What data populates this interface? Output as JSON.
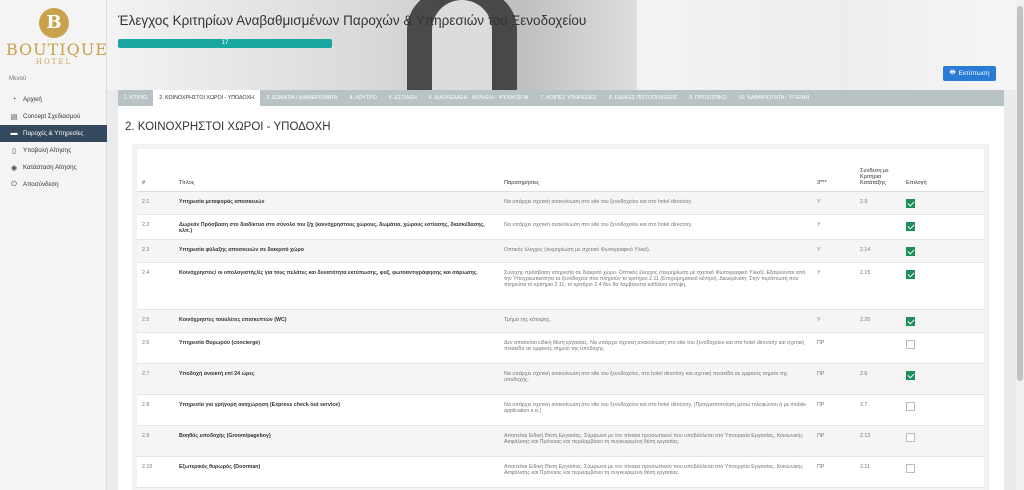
{
  "brand": {
    "logo_letter": "B",
    "name": "BOUTIQUE",
    "sub": "HOTEL"
  },
  "sidebar": {
    "menu_label": "Μενού",
    "items": [
      {
        "label": "Αρχική",
        "icon": "dashboard-icon",
        "glyph": "◔",
        "active": false
      },
      {
        "label": "Concept Σχεδιασμού",
        "icon": "book-icon",
        "glyph": "▤",
        "active": false
      },
      {
        "label": "Παροχές & Υπηρεσίες",
        "icon": "bed-icon",
        "glyph": "▬",
        "active": true
      },
      {
        "label": "Υποβολή Αίτησης",
        "icon": "file-icon",
        "glyph": "▯",
        "active": false
      },
      {
        "label": "Κατάσταση Αίτησης",
        "icon": "check-circle-icon",
        "glyph": "◉",
        "active": false
      },
      {
        "label": "Αποσύνδεση",
        "icon": "power-icon",
        "glyph": "⏻",
        "active": false
      }
    ]
  },
  "header": {
    "title": "Έλεγχος Κριτηρίων Αναβαθμισμένων Παροχών & Υπηρεσιών του Ξενοδοχείου",
    "progress_value": 17,
    "progress_label": "17",
    "print_label": "Εκτύπωση"
  },
  "tabs": [
    {
      "label": "1. ΚΤΙΡΙΟ",
      "active": false
    },
    {
      "label": "2. ΚΟΙΝΟΧΡΗΣΤΟΙ ΧΩΡΟΙ - ΥΠΟΔΟΧΗ",
      "active": true
    },
    {
      "label": "3. ΔΩΜΑΤΙΑ / ΔΙΑΜΕΡΙΣΜΑΤΑ",
      "active": false
    },
    {
      "label": "4. ΛΟΥΤΡΟ",
      "active": false
    },
    {
      "label": "5. ΕΣΤΙΑΣΗ",
      "active": false
    },
    {
      "label": "6. ΔΙΑΣΚΕΔΑΣΗ - ΑΘΛΗΣΗ - ΨΥΧΑΓΩΓΙΑ",
      "active": false
    },
    {
      "label": "7. ΛΟΙΠΕΣ ΥΠΗΡΕΣΙΕΣ",
      "active": false
    },
    {
      "label": "8. ΕΙΔΙΚΕΣ ΠΙΣΤΟΠΟΙΗΣΕΙΣ",
      "active": false
    },
    {
      "label": "9. ΠΡΟΣΩΠΙΚΟ",
      "active": false
    },
    {
      "label": "10. ΚΑΘΑΡΙΟΤΗΤΑ - ΥΓΙΕΙΝΗ",
      "active": false
    }
  ],
  "section": {
    "title": "2. ΚΟΙΝΟΧΡΗΣΤΟΙ ΧΩΡΟΙ - ΥΠΟΔΟΧΗ"
  },
  "table": {
    "headers": {
      "num": "#",
      "title": "Τίτλος",
      "notes": "Παρατηρήσεις",
      "stars": "3***",
      "link": "Συνδεση με Κριτήρια Κατάταξης",
      "select": "Επιλογή"
    },
    "rows": [
      {
        "num": "2.1",
        "title": "Υπηρεσία μεταφοράς αποσκευών",
        "notes": "Να υπάρχει σχετική ανακοίνωση στο site του ξενοδοχείου και στο hotel directory.",
        "stars": "Y",
        "link": "2.9",
        "checked": true
      },
      {
        "num": "2.2",
        "title": "Δωρεάν Πρόσβαση στο διαδίκτυο στο σύνολο του ξ/χ (κοινόχρηστους χώρους, δωμάτια, χώρους εστίασης, διασκέδασης, κλπ.)",
        "notes": "Να υπάρχει σχετική ανακοίνωση στο site του ξενοδοχείου και στο hotel directory.",
        "stars": "Y",
        "link": "",
        "checked": true
      },
      {
        "num": "2.3",
        "title": "Υπηρεσία φύλαξης αποσκευών σε διακριτό χώρο",
        "notes": "Οπτικός έλεγχος (τεκμηρίωση με σχετικό Φωτογραφικό Υλικό).",
        "stars": "Y",
        "link": "2.14",
        "checked": true
      },
      {
        "num": "2.4",
        "title": "Κοινόχρηστος/ οι υπολογιστής/ές για τους πελάτες και δυνατότητα εκτύπωσης, φαξ, φωτοαντιγράφησης και σάρωσης.",
        "notes": "Συνεχής πρόσβαση υπηρεσία σε διακριτό χώρο. Οπτικός έλεγχος (τεκμηρίωση με σχετικό Φωτογραφικό Υλικό). Εξαιρούνται από την Υποχρεωτικότητα τα ξενοδοχεία που πληρούν το κριτήριο 2.11 (Επιχειρηματικό κέντρο). Διευκρίνιση: Στην περίπτωση που πληρείται το κριτήριο 2.11, το κριτήριο 2.4 δεν θα λαμβάνεται καθόλου υπόψη.",
        "stars": "Y",
        "link": "2.15",
        "checked": true
      },
      {
        "num": "2.5",
        "title": "Κοινόχρηστες τουαλέτες επισκεπτών (WC)",
        "notes": "Τμήμα της κάτοψης.",
        "stars": "Y",
        "link": "2.20",
        "checked": true
      },
      {
        "num": "2.6",
        "title": "Υπηρεσία Θυρωρού (concierge)",
        "notes": "Δεν απαιτείται ειδική θέση εργασίας. Να υπάρχει σχετική ανακοίνωση στο site του ξενοδοχείου και στο hotel directory και σχετική πινακίδα σε εμφανές σημείο της υποδοχής.",
        "stars": "ΠΡ",
        "link": "",
        "checked": false
      },
      {
        "num": "2.7",
        "title": "Υποδοχή ανοικτή επί 24 ώρες",
        "notes": "Να υπάρχει σχετική ανακοίνωση στο site του ξενοδοχείου, στο hotel directory και σχετική πινακίδα σε εμφανές σημείο της υποδοχής.",
        "stars": "ΠΡ",
        "link": "2.6",
        "checked": true
      },
      {
        "num": "2.8",
        "title": "Υπηρεσία για γρήγορη αναχώρηση (Express check out service)",
        "notes": "Να υπάρχει σχετική ανακοίνωση στο site του ξενοδοχείου και στο hotel directory. (Πραγματοποίηση μέσω τηλεφώνου ή με mobile application κ.α.)",
        "stars": "ΠΡ",
        "link": "2.7",
        "checked": false
      },
      {
        "num": "2.9",
        "title": "Βοηθός υποδοχής (Groom/pageboy)",
        "notes": "Απαιτείται Ειδική Θέση Εργασίας. Σύμφωνα με τον πίνακα προσωπικού που υποβάλλεται στο Υπουργείο Εργασίας, Κοινωνικής Ασφάλισης και Πρόνοιας και περιλαμβάνει τη συγκεκριμένη θέση εργασίας.",
        "stars": "ΠΡ",
        "link": "2.13",
        "checked": false
      },
      {
        "num": "2.10",
        "title": "Εξωτερικός θυρωρός (Doorman)",
        "notes": "Απαιτείται Ειδική Θέση Εργασίας. Σύμφωνα με τον πίνακα προσωπικού που υποβάλλεται στο Υπουργείο Εργασίας, Κοινωνικής Ασφάλισης και Πρόνοιας και περιλαμβάνει τη συγκεκριμένη θέση εργασίας.",
        "stars": "ΠΡ",
        "link": "2.11",
        "checked": false
      },
      {
        "num": "",
        "title": "",
        "notes": "",
        "stars": "",
        "link": "",
        "checked": false
      }
    ]
  }
}
